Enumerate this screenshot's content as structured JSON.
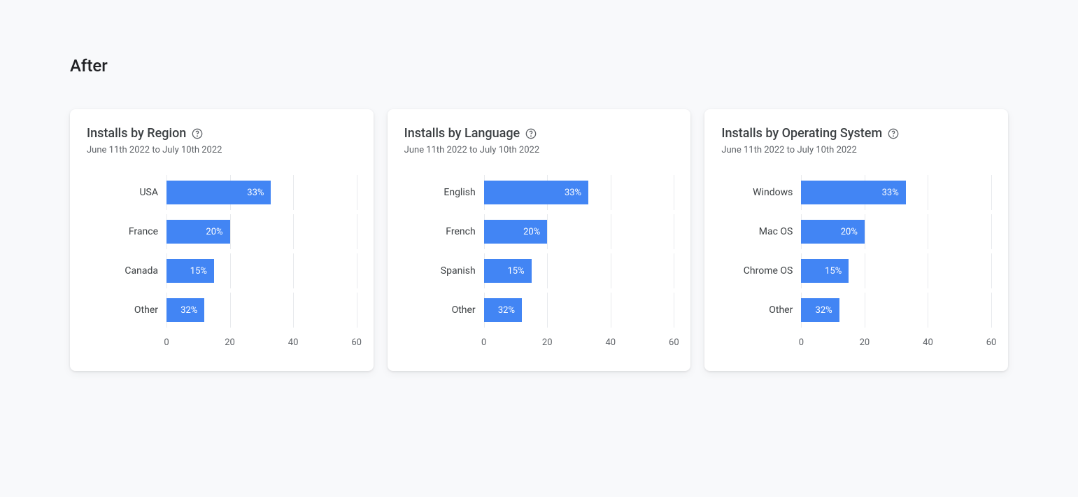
{
  "page_title": "After",
  "date_range": "June 11th 2022 to July 10th 2022",
  "axis_max": 60,
  "ticks": [
    0,
    20,
    40,
    60
  ],
  "cards": [
    {
      "title": "Installs by Region",
      "rows": [
        {
          "label": "USA",
          "value": 33,
          "value_label": "33%"
        },
        {
          "label": "France",
          "value": 20,
          "value_label": "20%"
        },
        {
          "label": "Canada",
          "value": 15,
          "value_label": "15%"
        },
        {
          "label": "Other",
          "value": 32,
          "value_label": "32%",
          "width_override": 12
        }
      ]
    },
    {
      "title": "Installs by Language",
      "rows": [
        {
          "label": "English",
          "value": 33,
          "value_label": "33%"
        },
        {
          "label": "French",
          "value": 20,
          "value_label": "20%"
        },
        {
          "label": "Spanish",
          "value": 15,
          "value_label": "15%"
        },
        {
          "label": "Other",
          "value": 32,
          "value_label": "32%",
          "width_override": 12
        }
      ]
    },
    {
      "title": "Installs by Operating System",
      "rows": [
        {
          "label": "Windows",
          "value": 33,
          "value_label": "33%"
        },
        {
          "label": "Mac OS",
          "value": 20,
          "value_label": "20%"
        },
        {
          "label": "Chrome OS",
          "value": 15,
          "value_label": "15%"
        },
        {
          "label": "Other",
          "value": 32,
          "value_label": "32%",
          "width_override": 12
        }
      ]
    }
  ],
  "chart_data": [
    {
      "type": "bar",
      "title": "Installs by Region",
      "subtitle": "June 11th 2022 to July 10th 2022",
      "xlabel": "",
      "ylabel": "",
      "xlim": [
        0,
        60
      ],
      "categories": [
        "USA",
        "France",
        "Canada",
        "Other"
      ],
      "values": [
        33,
        20,
        15,
        32
      ],
      "value_labels": [
        "33%",
        "20%",
        "15%",
        "32%"
      ]
    },
    {
      "type": "bar",
      "title": "Installs by Language",
      "subtitle": "June 11th 2022 to July 10th 2022",
      "xlabel": "",
      "ylabel": "",
      "xlim": [
        0,
        60
      ],
      "categories": [
        "English",
        "French",
        "Spanish",
        "Other"
      ],
      "values": [
        33,
        20,
        15,
        32
      ],
      "value_labels": [
        "33%",
        "20%",
        "15%",
        "32%"
      ]
    },
    {
      "type": "bar",
      "title": "Installs by Operating System",
      "subtitle": "June 11th 2022 to July 10th 2022",
      "xlabel": "",
      "ylabel": "",
      "xlim": [
        0,
        60
      ],
      "categories": [
        "Windows",
        "Mac OS",
        "Chrome OS",
        "Other"
      ],
      "values": [
        33,
        20,
        15,
        32
      ],
      "value_labels": [
        "33%",
        "20%",
        "15%",
        "32%"
      ]
    }
  ]
}
